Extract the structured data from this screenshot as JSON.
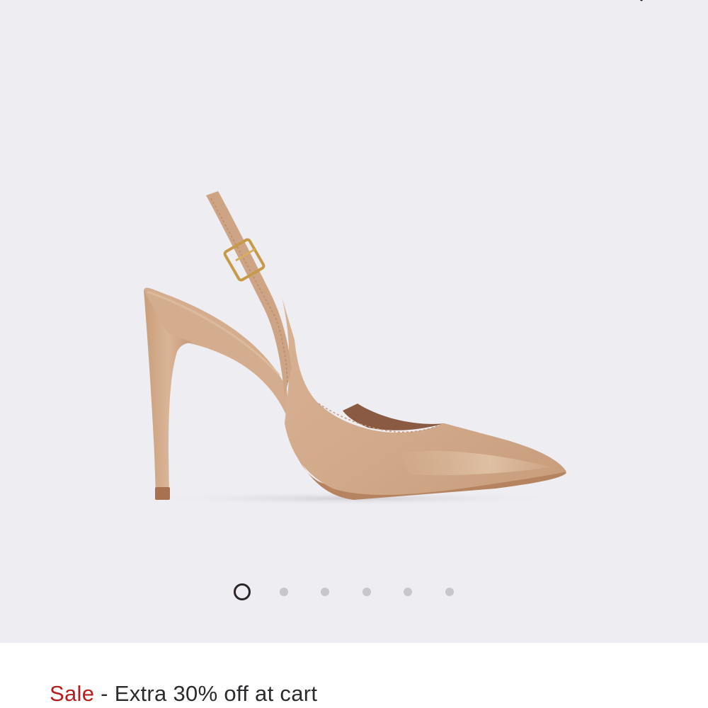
{
  "product": {
    "image_alt": "Beige patent slingback pointed-toe stiletto pump"
  },
  "wishlist": {
    "icon": "heart-icon"
  },
  "carousel": {
    "total": 6,
    "active_index": 0
  },
  "promo": {
    "sale_label": "Sale",
    "separator": "-",
    "text": "Extra 30% off at cart"
  },
  "colors": {
    "background": "#eeedf1",
    "sale": "#b81d1d",
    "dot_inactive": "#c7c6cb",
    "dot_active": "#2b2528",
    "shoe": "#d2aa8a"
  }
}
